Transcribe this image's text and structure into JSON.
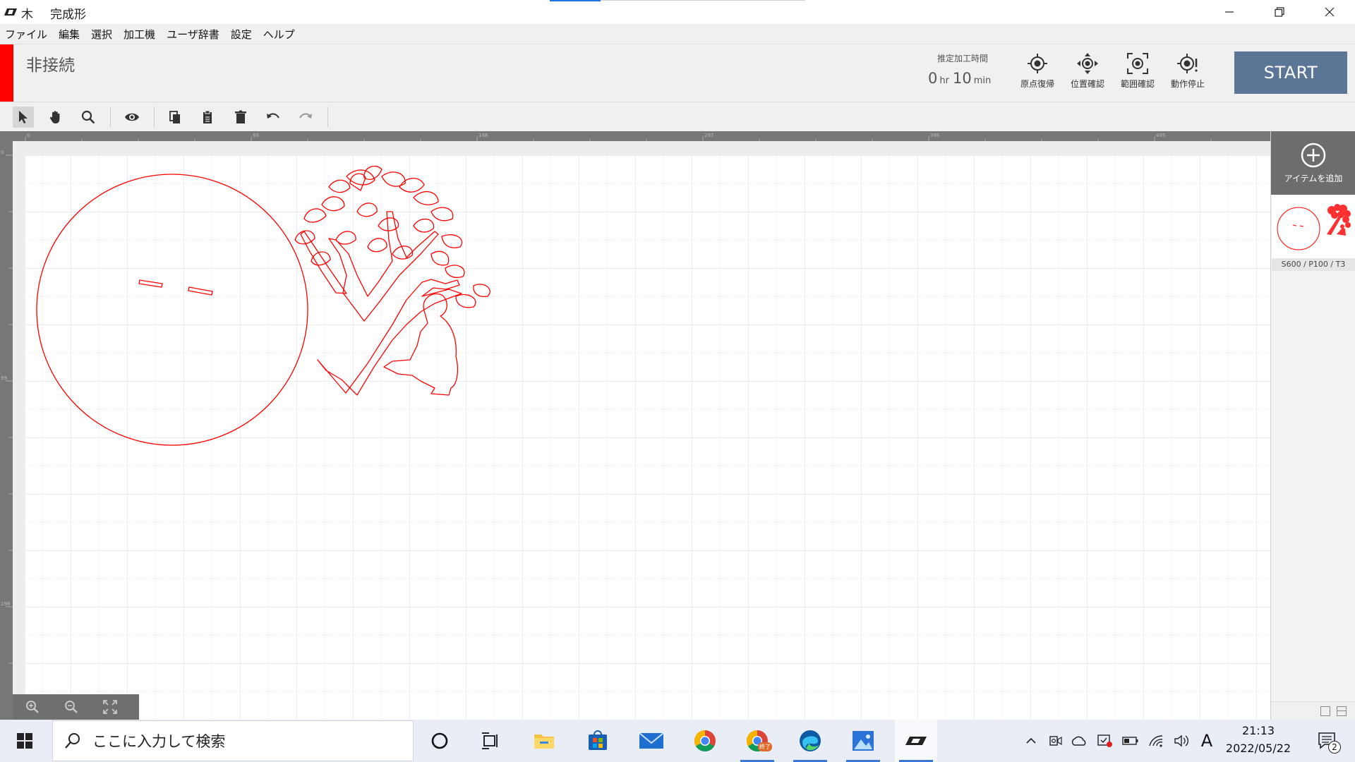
{
  "window": {
    "title_parts": [
      "木",
      "完成形"
    ]
  },
  "menu": {
    "items": [
      "ファイル",
      "編集",
      "選択",
      "加工機",
      "ユーザ辞書",
      "設定",
      "ヘルプ"
    ]
  },
  "header": {
    "connection_status": "非接続",
    "estimate_label": "推定加工時間",
    "estimate_hours": "0",
    "estimate_hours_unit": "hr",
    "estimate_minutes": "10",
    "estimate_minutes_unit": "min",
    "tools": [
      "原点復帰",
      "位置確認",
      "範囲確認",
      "動作停止"
    ],
    "start_label": "START"
  },
  "toolbar": {
    "icons": [
      "select-arrow-icon",
      "hand-pan-icon",
      "magnifier-icon",
      "eye-icon",
      "copy-icon",
      "paste-icon",
      "trash-icon",
      "undo-icon",
      "redo-icon"
    ]
  },
  "ruler": {
    "top_labels": [
      "0",
      "99",
      "198",
      "297",
      "396",
      "495"
    ],
    "left_labels": [
      "0",
      "99",
      "198"
    ]
  },
  "right_panel": {
    "add_item_label": "アイテムを追加",
    "item_params": "S600 / P100 / T3"
  },
  "taskbar": {
    "search_placeholder": "ここに入力して検索",
    "clock_time": "21:13",
    "clock_date": "2022/05/22",
    "notification_count": "2",
    "ime_indicator": "A",
    "chrome_badge": "終了"
  },
  "colors": {
    "cut_line": "#ff0000",
    "start_button": "#5b7597",
    "status_indicator": "#ff0000"
  }
}
